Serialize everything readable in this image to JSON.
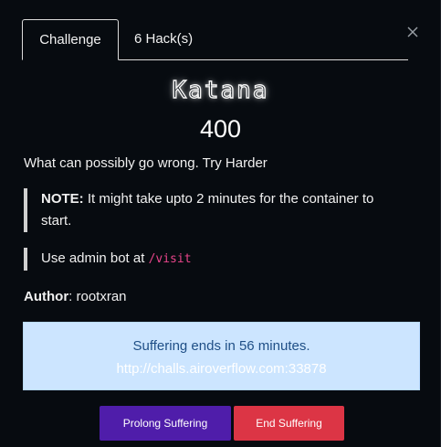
{
  "tabs": [
    {
      "label": "Challenge",
      "active": true
    },
    {
      "label": "6 Hack(s)",
      "active": false
    }
  ],
  "challenge": {
    "name": "Katana",
    "points": "400",
    "description": "What can possibly go wrong. Try Harder",
    "note_label": "NOTE:",
    "note_text": " It might take upto 2 minutes for the container to start.",
    "bot_text": "Use admin bot at ",
    "bot_path": "/visit",
    "author_label": "Author",
    "author_value": ": rootxran"
  },
  "instance": {
    "status": "Suffering ends in 56 minutes.",
    "url": "http://challs.airoverflow.com:33878"
  },
  "buttons": {
    "prolong": "Prolong Suffering",
    "end": "End Suffering"
  },
  "icons": {
    "close": "close-icon"
  },
  "colors": {
    "background": "#070b10",
    "info_bg": "#cce5ff",
    "info_text": "#1f4f86",
    "prolong": "#4f1daa",
    "end": "#dc3545",
    "code": "#e8458b"
  }
}
